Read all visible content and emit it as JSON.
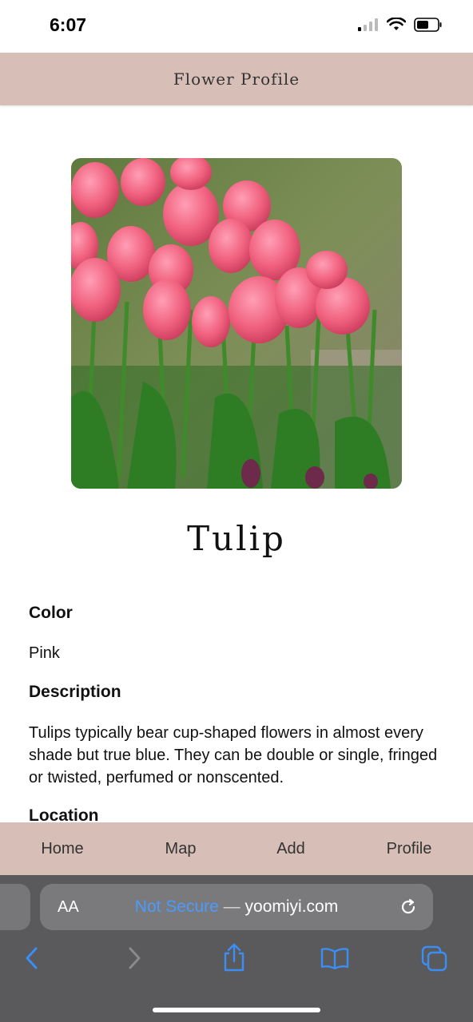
{
  "status": {
    "time": "6:07"
  },
  "header": {
    "title": "Flower Profile"
  },
  "flower": {
    "name": "Tulip",
    "image_icon": "tulip-photo",
    "sections": {
      "color": {
        "heading": "Color",
        "value": "Pink"
      },
      "description": {
        "heading": "Description",
        "value": "Tulips typically bear cup-shaped flowers in almost every shade but true blue. They can be double or single, fringed or twisted, perfumed or nonscented."
      },
      "location": {
        "heading": "Location"
      }
    }
  },
  "nav": {
    "home": "Home",
    "map": "Map",
    "add": "Add",
    "profile": "Profile"
  },
  "browser": {
    "aa": "AA",
    "not_secure": "Not Secure",
    "separator": " — ",
    "domain": "yoomiyi.com"
  },
  "colors": {
    "header_bg": "#d7beb6",
    "browser_bg": "#5a5a5c",
    "link_blue": "#4a9bff"
  }
}
